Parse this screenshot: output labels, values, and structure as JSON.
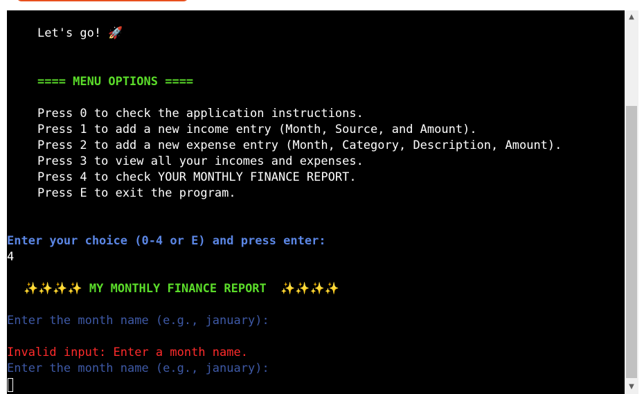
{
  "terminal": {
    "greeting": "Let's go!",
    "greeting_emoji": "🚀",
    "menu_title": "==== MENU OPTIONS ====",
    "menu_items": [
      "Press 0 to check the application instructions.",
      "Press 1 to add a new income entry (Month, Source, and Amount).",
      "Press 2 to add a new expense entry (Month, Category, Description, Amount).",
      "Press 3 to view all your incomes and expenses.",
      "Press 4 to check YOUR MONTHLY FINANCE REPORT.",
      "Press E to exit the program."
    ],
    "choice_prompt": "Enter your choice (0-4 or E) and press enter:",
    "choice_value": "4",
    "report_sparkles_left": "✨✨✨✨",
    "report_title": " MY MONTHLY FINANCE REPORT  ",
    "report_sparkles_right": "✨✨✨✨",
    "month_prompt_1": "Enter the month name (e.g., january):",
    "error_message": "Invalid input: Enter a month name.",
    "month_prompt_2": "Enter the month name (e.g., january):"
  },
  "scrollbar": {
    "up_arrow": "▲",
    "down_arrow": "▼"
  },
  "colors": {
    "background": "#000000",
    "text": "#ffffff",
    "menu_green": "#5bdc2a",
    "prompt_blue": "#5b86e4",
    "dim_blue": "#3e59a6",
    "error_red": "#ff2b2b"
  }
}
